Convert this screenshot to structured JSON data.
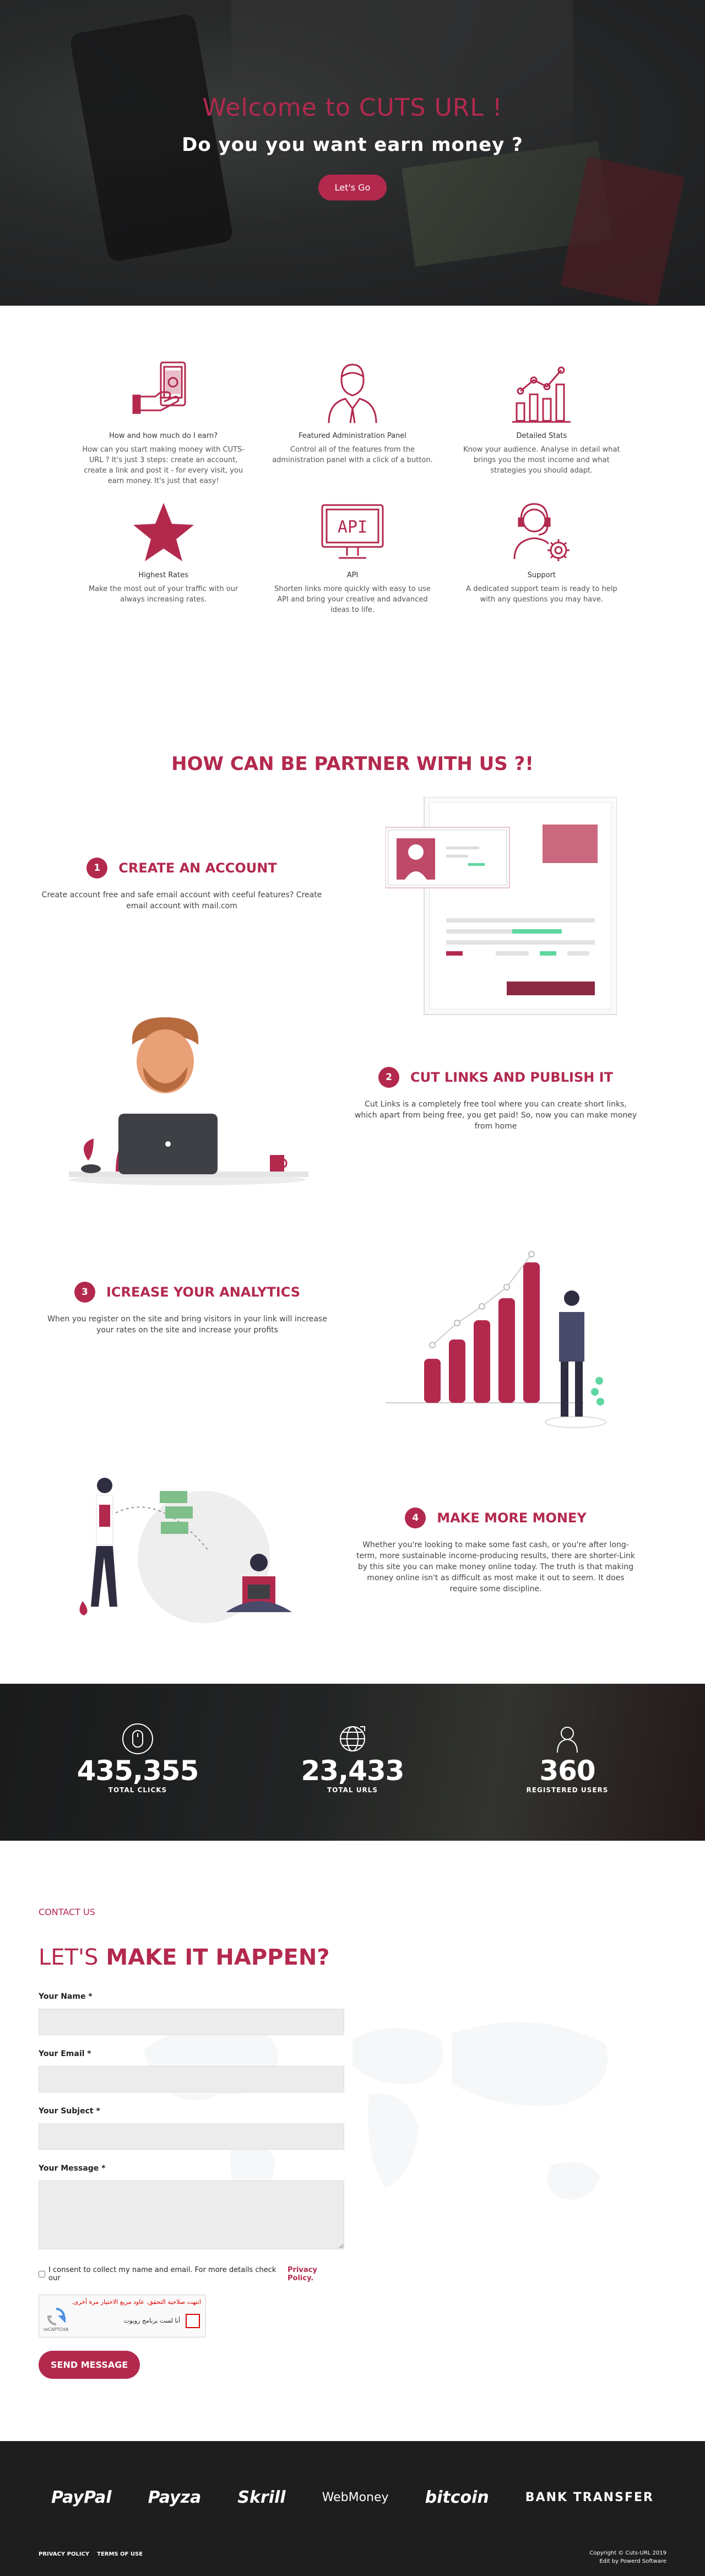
{
  "hero": {
    "title": "Welcome to CUTS URL !",
    "subtitle": "Do you you want earn money ?",
    "button": "Let's Go"
  },
  "features": [
    {
      "icon": "money-phone-icon",
      "title": "How and how much do I earn?",
      "desc": "How can you start making money with CUTS-URL ? It's just 3 steps: create an account, create a link and post it - for every visit, you earn money. It's just that easy!"
    },
    {
      "icon": "admin-user-icon",
      "title": "Featured Administration Panel",
      "desc": "Control all of the features from the administration panel with a click of a button."
    },
    {
      "icon": "stats-chart-icon",
      "title": "Detailed Stats",
      "desc": "Know your audience. Analyse in detail what brings you the most income and what strategies you should adapt."
    },
    {
      "icon": "star-icon",
      "title": "Highest Rates",
      "desc": "Make the most out of your traffic with our always increasing rates."
    },
    {
      "icon": "api-monitor-icon",
      "title": "API",
      "desc": "Shorten links more quickly with easy to use API and bring your creative and advanced ideas to life."
    },
    {
      "icon": "support-agent-icon",
      "title": "Support",
      "desc": "A dedicated support team is ready to help with any questions you may have."
    }
  ],
  "partner": {
    "heading": "HOW CAN BE PARTNER WITH US ?!",
    "steps": [
      {
        "num": "1",
        "title": "CREATE AN ACCOUNT",
        "desc": "Create account free and safe email account with ceeful features? Create email account with mail.com"
      },
      {
        "num": "2",
        "title": "CUT LINKS AND PUBLISH IT",
        "desc": "Cut Links is a completely free tool where you can create short links, which apart from being free, you get paid! So, now you can make money from home"
      },
      {
        "num": "3",
        "title": "ICREASE YOUR ANALYTICS",
        "desc": "When you register on the site and bring visitors in your link will increase your rates on the site and increase your profits"
      },
      {
        "num": "4",
        "title": "MAKE MORE MONEY",
        "desc": "Whether you're looking to make some fast cash, or you're after long-term, more sustainable income-producing results, there are shorter-Link by this site you can make money online today. The truth is that making money online isn't as difficult as most make it out to seem. It does require some discipline."
      }
    ]
  },
  "counters": [
    {
      "icon": "mouse-icon",
      "value": "435,355",
      "label": "TOTAL CLICKS"
    },
    {
      "icon": "globe-link-icon",
      "value": "23,433",
      "label": "TOTAL URLS"
    },
    {
      "icon": "user-icon",
      "value": "360",
      "label": "REGISTERED USERS"
    }
  ],
  "contact": {
    "kicker": "CONTACT US",
    "title_part1": "LET'S",
    "title_part2": "MAKE IT HAPPEN?",
    "name_label": "Your Name *",
    "email_label": "Your Email *",
    "subject_label": "Your Subject *",
    "message_label": "Your Message *",
    "consent_text": "I consent to collect my name and email. For more details check our",
    "consent_link": "Privacy Policy.",
    "captcha_error": "انتهت صلاحية التحقق. عاود مربع الاختيار مرة أخرى.",
    "captcha_label": "أنا لست برنامج روبوت",
    "captcha_brand": "reCAPTCHA",
    "submit": "SEND MESSAGE"
  },
  "footer": {
    "payments": [
      "PayPal",
      "Payza",
      "Skrill",
      "WebMoney",
      "bitcoin",
      "BANK TRANSFER"
    ],
    "links": [
      "PRIVACY POLICY",
      "TERMS OF USE"
    ],
    "copyright": "Copyright © Cuts-URL 2019",
    "credit": "Edit by Powerd Software"
  },
  "colors": {
    "accent": "#b3294e",
    "dark": "#1e1e1f"
  }
}
